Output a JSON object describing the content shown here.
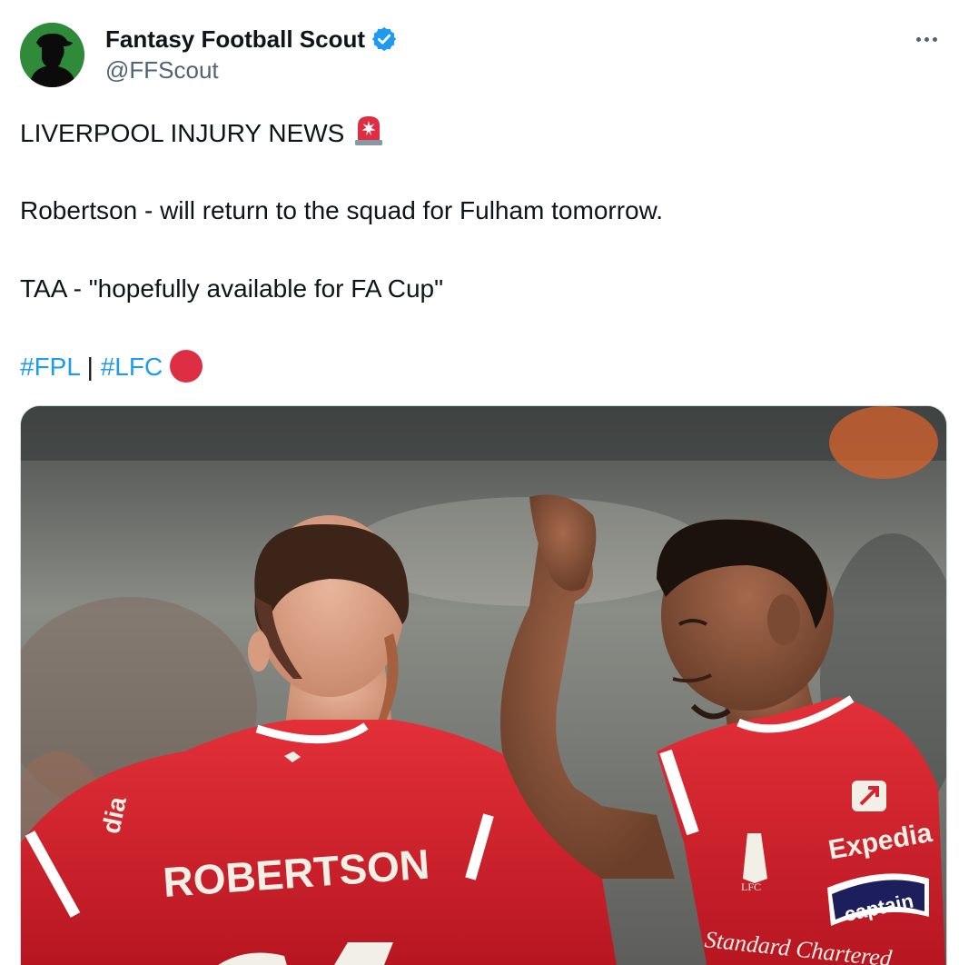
{
  "author": {
    "display_name": "Fantasy Football Scout",
    "handle": "@FFScout",
    "verified": true,
    "avatar_icon": "scout-silhouette-avatar",
    "avatar_bg": "#2f8a3a"
  },
  "tweet": {
    "lines": {
      "headline": "LIVERPOOL INJURY NEWS",
      "robertson": "Robertson - will return to the squad for Fulham tomorrow.",
      "taa": "TAA - \"hopefully available for FA Cup\""
    },
    "hashtags": [
      "#FPL",
      "#LFC"
    ],
    "hashtag_separator": "|",
    "headline_icon": "siren-icon",
    "hashtag_icon": "red-circle-icon",
    "hashtag_color": "#1d9bf0"
  },
  "media": {
    "type": "photo",
    "description_icon": "photo-two-liverpool-players",
    "visible_text": {
      "player_name": "ROBERTSON",
      "sponsor": "Expedia",
      "armband": "captain",
      "club_badge": "LFC",
      "sleeve_sponsor": "Standard Chartered",
      "side_text": "dia"
    },
    "jersey_color": "#d9242f"
  },
  "menu": {
    "more_icon": "more-horizontal-icon"
  }
}
